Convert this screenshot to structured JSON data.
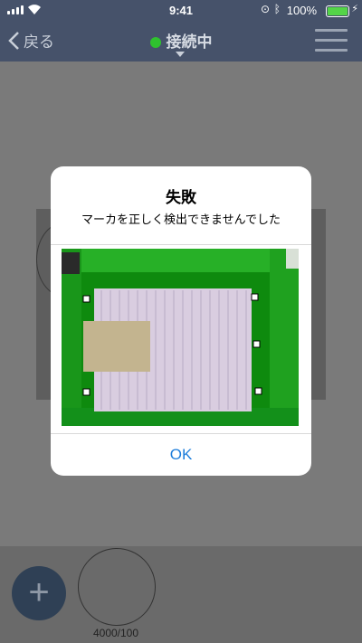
{
  "status_bar": {
    "time": "9:41",
    "battery": "100%",
    "battery_level": 1.0,
    "icons": [
      "signal-icon",
      "wifi-icon",
      "orientation-lock-icon",
      "bluetooth-icon",
      "battery-icon",
      "charging-icon"
    ]
  },
  "nav": {
    "back_label": "戻る",
    "connection_status": "接続中",
    "connection_color": "#2fc12f"
  },
  "dialog": {
    "title": "失敗",
    "message": "マーカを正しく検出できませんでした",
    "ok_label": "OK",
    "ok_color": "#1d7ddb"
  },
  "bottom_bar": {
    "add_label": "+",
    "thumbnail_caption": "4000/100"
  }
}
